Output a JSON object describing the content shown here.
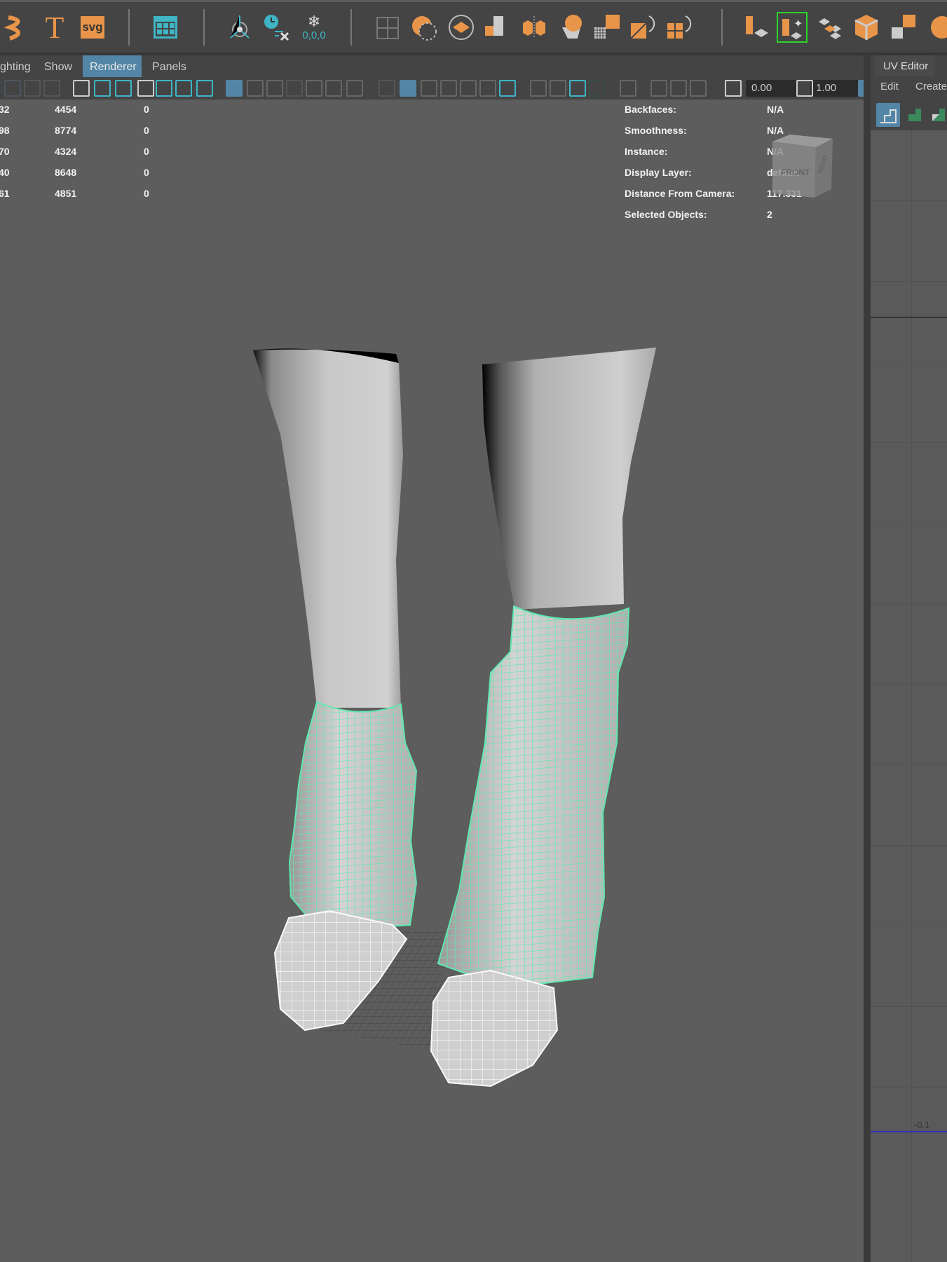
{
  "shelf": {
    "icons": [
      "twist-icon",
      "text-icon",
      "svg-icon",
      "grid-window-icon",
      "pivot-icon",
      "history-delete-icon",
      "freeze-transform-icon",
      "split-view-icon",
      "lasso-circle-icon",
      "plane-cut-icon",
      "combine-icon",
      "separate-icon",
      "boolean-icon",
      "subdivide-icon",
      "rotate-face-icon",
      "rotate-edge-icon",
      "uv-planar-icon",
      "uv-auto-icon",
      "uv-layout-icon",
      "uv-cube-icon",
      "uv-unfold-icon",
      "uv-sphere-icon"
    ],
    "svg_label": "svg",
    "freeze_label": "0,0,0",
    "colors": {
      "orange": "#e8954a",
      "teal": "#3fb5c6",
      "selected_outline": "#2bd62b"
    }
  },
  "menubar": {
    "items": [
      "ghting",
      "Show",
      "Renderer",
      "Panels"
    ],
    "active": "Renderer"
  },
  "toolbar": {
    "exposure": "0.00",
    "gamma": "1.00"
  },
  "stats": {
    "rows": [
      [
        "32",
        "4454",
        "0"
      ],
      [
        "98",
        "8774",
        "0"
      ],
      [
        "70",
        "4324",
        "0"
      ],
      [
        "40",
        "8648",
        "0"
      ],
      [
        "61",
        "4851",
        "0"
      ]
    ]
  },
  "hud": {
    "rows": [
      {
        "label": "Backfaces:",
        "value": "N/A"
      },
      {
        "label": "Smoothness:",
        "value": "N/A"
      },
      {
        "label": "Instance:",
        "value": "N/A"
      },
      {
        "label": "Display Layer:",
        "value": "default"
      },
      {
        "label": "Distance From Camera:",
        "value": "117.331"
      },
      {
        "label": "Selected Objects:",
        "value": "2"
      }
    ]
  },
  "viewcube": {
    "front": "FRONT",
    "right": "RIGHT"
  },
  "uv_editor": {
    "title": "UV Editor",
    "menu": [
      "Edit",
      "Create"
    ],
    "axis_label": "-0.1",
    "axis_color": "#3030c0"
  },
  "scene": {
    "wire_color": "#5fe8b0"
  }
}
